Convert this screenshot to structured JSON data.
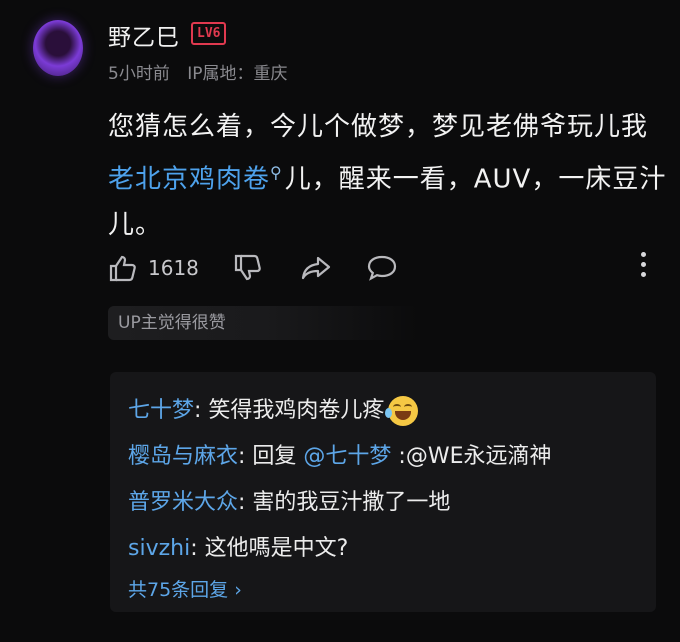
{
  "comment": {
    "user_name": "野乙巳",
    "level_badge": "LV6",
    "time": "5小时前",
    "ip_location": "IP属地：重庆",
    "text_part1": "您猜怎么着，今儿个做梦，梦见老佛爷玩儿我",
    "text_highlight": "老北京鸡肉卷",
    "text_part2": "儿，醒来一看，AUV，一床豆汁儿。",
    "likes": "1618",
    "up_tag": "UP主觉得很赞"
  },
  "replies": [
    {
      "author": "七十梦",
      "sep": ": ",
      "text": "笑得我鸡肉卷儿疼",
      "emoji": "laughing-crying-emoji"
    },
    {
      "author": "樱岛与麻衣",
      "sep": ": ",
      "text_pre": "回复 ",
      "mention": "@七十梦",
      "text": " :@WE永远滴神"
    },
    {
      "author": "普罗米大众",
      "sep": ": ",
      "text": "害的我豆汁撒了一地"
    },
    {
      "author": "sivzhi",
      "sep": ": ",
      "text": "这他嗎是中文?"
    }
  ],
  "total_replies": "共75条回复",
  "colors": {
    "link": "#5da6e8",
    "badge": "#e0394f",
    "background": "#0b0b0c"
  },
  "icons": [
    "thumbs-up-icon",
    "thumbs-down-icon",
    "share-icon",
    "comment-icon",
    "more-icon",
    "search-icon",
    "chevron-right-icon"
  ]
}
